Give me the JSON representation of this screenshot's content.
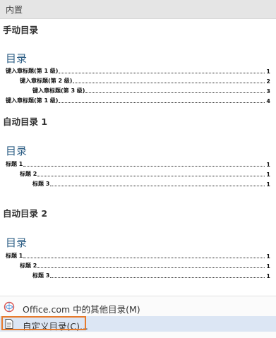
{
  "header": {
    "title": "内置"
  },
  "sections": [
    {
      "title": "手动目录",
      "toc_heading": "目录",
      "lines": [
        {
          "text": "键入章标题(第 1 级)",
          "page": "1"
        },
        {
          "text": "键入章标题(第 2 级)",
          "page": "2"
        },
        {
          "text": "键入章标题(第 3 级)",
          "page": "3"
        },
        {
          "text": "键入章标题(第 1 级)",
          "page": "4"
        }
      ]
    },
    {
      "title": "自动目录 1",
      "toc_heading": "目录",
      "lines": [
        {
          "text": "标题 1",
          "page": "1"
        },
        {
          "text": "标题 2",
          "page": "1"
        },
        {
          "text": "标题 3",
          "page": "1"
        }
      ]
    },
    {
      "title": "自动目录 2",
      "toc_heading": "目录",
      "lines": [
        {
          "text": "标题 1",
          "page": "1"
        },
        {
          "text": "标题 2",
          "page": "1"
        },
        {
          "text": "标题 3",
          "page": "1"
        }
      ]
    }
  ],
  "menu": {
    "office_more": "Office.com 中的其他目录(M)",
    "custom_toc": "自定义目录(C)..."
  },
  "colors": {
    "heading_blue": "#2e5f86",
    "highlight_orange": "#e77a2b",
    "selection_bg": "#dce6f4"
  }
}
